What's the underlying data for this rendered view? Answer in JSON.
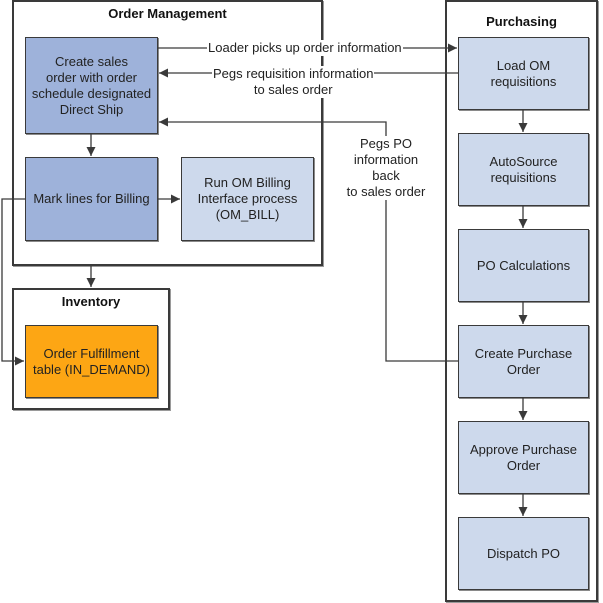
{
  "diagram": {
    "colors": {
      "om_primary": "#9eb2da",
      "process": "#cdd9ec",
      "inventory": "#fda614",
      "line": "#3a3a3a"
    },
    "frames": {
      "order_management": {
        "title": "Order Management"
      },
      "inventory": {
        "title": "Inventory"
      },
      "purchasing": {
        "title": "Purchasing"
      }
    },
    "nodes": {
      "create_sales_order": {
        "label": "Create sales\norder with order\nschedule designated\nDirect Ship"
      },
      "mark_lines_billing": {
        "label": "Mark lines for Billing"
      },
      "run_om_billing": {
        "label": "Run OM Billing\nInterface process\n(OM_BILL)"
      },
      "order_fulfillment": {
        "label": "Order Fulfillment\ntable (IN_DEMAND)"
      },
      "load_om_requisitions": {
        "label": "Load OM\nrequisitions"
      },
      "autosource_requisitions": {
        "label": "AutoSource\nrequisitions"
      },
      "po_calculations": {
        "label": "PO Calculations"
      },
      "create_purchase_order": {
        "label": "Create Purchase\nOrder"
      },
      "approve_purchase_order": {
        "label": "Approve Purchase\nOrder"
      },
      "dispatch_po": {
        "label": "Dispatch PO"
      }
    },
    "edge_labels": {
      "loader": "Loader picks up order information",
      "pegs_requisition": "Pegs requisition information\nto sales order",
      "pegs_po": "Pegs PO\ninformation\nback\nto sales order"
    }
  }
}
